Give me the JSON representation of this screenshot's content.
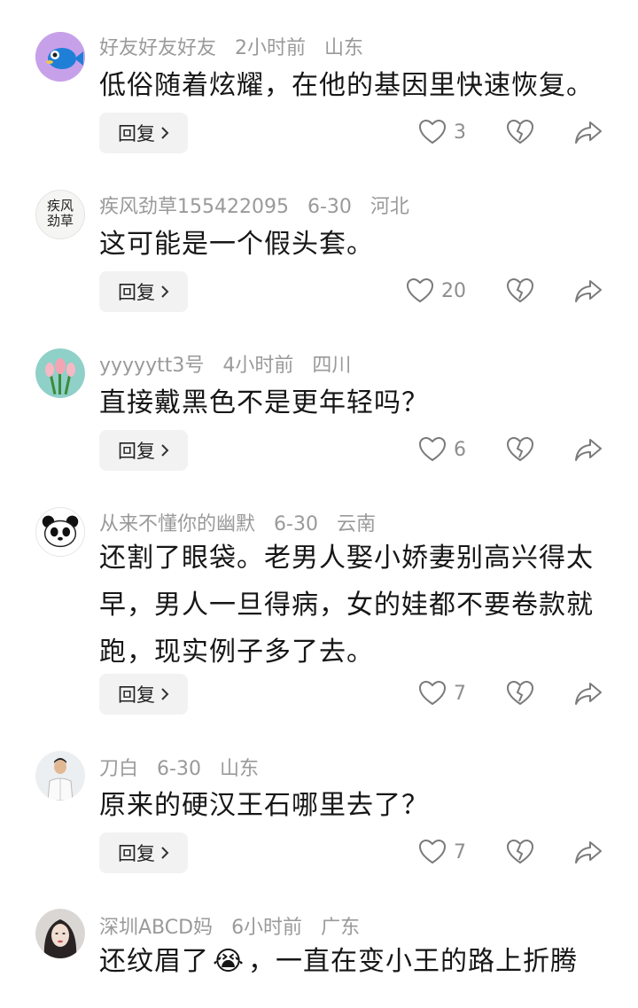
{
  "comments": [
    {
      "user": "好友好友好友",
      "time": "2小时前",
      "location": "山东",
      "text": "低俗随着炫耀，在他的基因里快速恢复。",
      "likes": "3",
      "avatar": "fish-avatar",
      "reply_label": "回复"
    },
    {
      "user": "疾风劲草155422095",
      "time": "6-30",
      "location": "河北",
      "text": "这可能是一个假头套。",
      "likes": "20",
      "avatar": "calligraphy-avatar",
      "avatar_text": "疾风劲草",
      "reply_label": "回复"
    },
    {
      "user": "yyyyytt3号",
      "time": "4小时前",
      "location": "四川",
      "text": "直接戴黑色不是更年轻吗？",
      "likes": "6",
      "avatar": "tulip-avatar",
      "reply_label": "回复"
    },
    {
      "user": "从来不懂你的幽默",
      "time": "6-30",
      "location": "云南",
      "text": "还割了眼袋。老男人娶小娇妻别高兴得太早，男人一旦得病，女的娃都不要卷款就跑，现实例子多了去。",
      "likes": "7",
      "avatar": "panda-avatar",
      "reply_label": "回复"
    },
    {
      "user": "刀白",
      "time": "6-30",
      "location": "山东",
      "text": "原来的硬汉王石哪里去了？",
      "likes": "7",
      "avatar": "person-avatar",
      "reply_label": "回复"
    },
    {
      "user": "深圳ABCD妈",
      "time": "6小时前",
      "location": "广东",
      "text_before": "还纹眉了",
      "emoji": "😭",
      "text_after": "，一直在变小王的路上折腾",
      "avatar": "woman-avatar"
    }
  ],
  "icons": {
    "like": "heart-outline-icon",
    "dislike": "broken-heart-icon",
    "share": "share-arrow-icon",
    "reply_chevron": "chevron-right-icon"
  }
}
